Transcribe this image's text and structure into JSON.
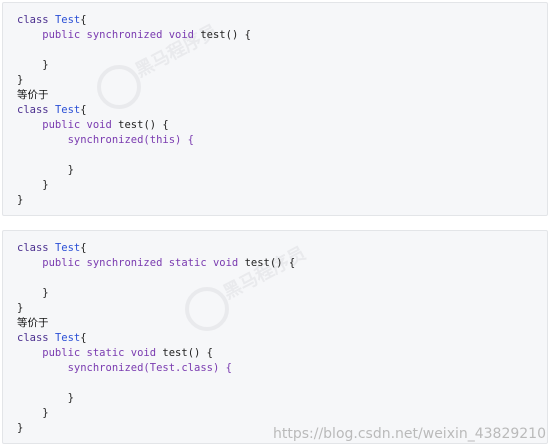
{
  "block1": {
    "lines": [
      [
        "class ",
        "Test",
        "{"
      ],
      [
        "    public synchronized void ",
        "test",
        "() {"
      ],
      [
        ""
      ],
      [
        "    }"
      ],
      [
        "}"
      ],
      [
        "等价于"
      ],
      [
        "class ",
        "Test",
        "{"
      ],
      [
        "    public void ",
        "test",
        "() {"
      ],
      [
        "        synchronized(this) {"
      ],
      [
        ""
      ],
      [
        "        }"
      ],
      [
        "    }"
      ],
      [
        "}"
      ]
    ]
  },
  "block2": {
    "lines": [
      [
        "class ",
        "Test",
        "{"
      ],
      [
        "    public synchronized static void ",
        "test",
        "() {"
      ],
      [
        ""
      ],
      [
        "    }"
      ],
      [
        "}"
      ],
      [
        "等价于"
      ],
      [
        "class ",
        "Test",
        "{"
      ],
      [
        "    public static void ",
        "test",
        "() {"
      ],
      [
        "        synchronized(Test.class) {"
      ],
      [
        ""
      ],
      [
        "        }"
      ],
      [
        "    }"
      ],
      [
        "}"
      ]
    ]
  },
  "watermark": {
    "brand_text": "黑马程序员",
    "csdn_url": "https://blog.csdn.net/weixin_43829210"
  }
}
